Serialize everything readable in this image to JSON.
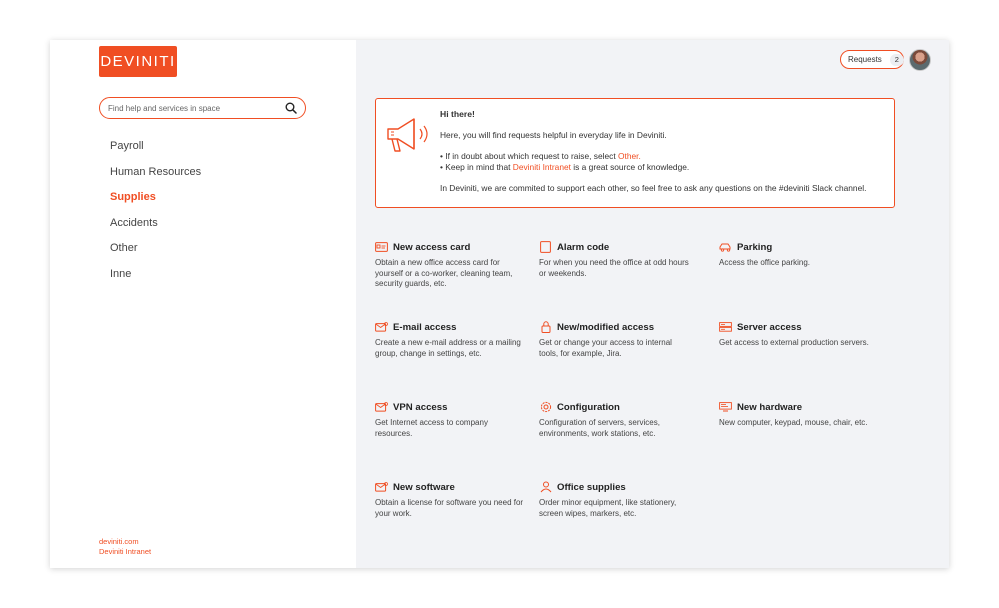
{
  "brand": {
    "logo_text": "DEVINITI",
    "accent": "#f04e23"
  },
  "search": {
    "placeholder": "Find help and services in space"
  },
  "nav": {
    "items": [
      {
        "label": "Payroll"
      },
      {
        "label": "Human Resources"
      },
      {
        "label": "Supplies",
        "active": true
      },
      {
        "label": "Accidents"
      },
      {
        "label": "Other"
      },
      {
        "label": "Inne"
      }
    ]
  },
  "footer": {
    "link1": "deviniti.com",
    "link2": "Deviniti Intranet"
  },
  "header": {
    "requests_label": "Requests",
    "requests_count": "2"
  },
  "banner": {
    "title": "Hi there!",
    "intro": "Here, you will find requests helpful in everyday life in Deviniti.",
    "bullet1_prefix": "• If in doubt about which request to raise, select ",
    "bullet1_link": "Other.",
    "bullet2_prefix": "• Keep in mind that ",
    "bullet2_link": "Deviniti Intranet",
    "bullet2_suffix": " is a great source of knowledge.",
    "closing": "In Deviniti, we are commited to support each other, so feel free to ask any questions on the #deviniti Slack channel."
  },
  "cards": [
    {
      "icon": "id-card-icon",
      "title": "New access card",
      "desc": "Obtain a new office access card for yourself or a co-worker, cleaning team, security guards, etc."
    },
    {
      "icon": "keypad-icon",
      "title": "Alarm code",
      "desc": "For when you need the office at odd hours or weekends."
    },
    {
      "icon": "car-icon",
      "title": "Parking",
      "desc": "Access the office parking."
    },
    {
      "icon": "email-icon",
      "title": "E-mail access",
      "desc": "Create a new e-mail address or a mailing group, change in settings, etc."
    },
    {
      "icon": "lock-icon",
      "title": "New/modified access",
      "desc": "Get or change your access to internal tools, for example, Jira."
    },
    {
      "icon": "server-icon",
      "title": "Server access",
      "desc": "Get access to external production servers."
    },
    {
      "icon": "vpn-icon",
      "title": "VPN access",
      "desc": "Get Internet access to company resources."
    },
    {
      "icon": "gear-icon",
      "title": "Configuration",
      "desc": "Configuration of servers, services, environments, work stations, etc."
    },
    {
      "icon": "hardware-icon",
      "title": "New hardware",
      "desc": "New computer, keypad, mouse, chair, etc."
    },
    {
      "icon": "software-icon",
      "title": "New software",
      "desc": "Obtain a license for software you need for your work."
    },
    {
      "icon": "supplies-icon",
      "title": "Office supplies",
      "desc": "Order minor equipment, like stationery, screen wipes, markers, etc."
    }
  ]
}
